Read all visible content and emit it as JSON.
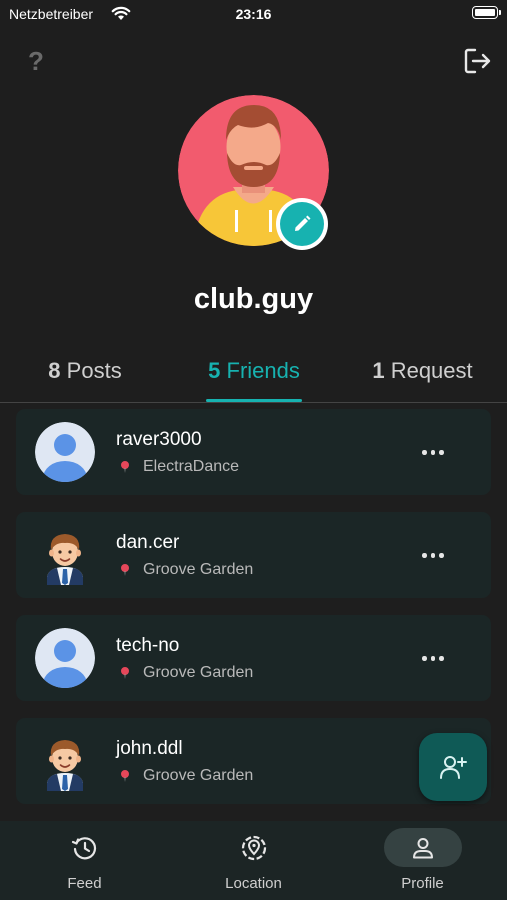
{
  "status_bar": {
    "carrier": "Netzbetreiber",
    "time": "23:16"
  },
  "profile": {
    "username": "club.guy"
  },
  "tabs": [
    {
      "count": "8",
      "label": "Posts"
    },
    {
      "count": "5",
      "label": "Friends",
      "active": true
    },
    {
      "count": "1",
      "label": "Request"
    }
  ],
  "friends": [
    {
      "name": "raver3000",
      "location": "ElectraDance",
      "avatar": "default-user-icon"
    },
    {
      "name": "dan.cer",
      "location": "Groove Garden",
      "avatar": "cartoon-man-icon"
    },
    {
      "name": "tech-no",
      "location": "Groove Garden",
      "avatar": "default-user-icon"
    },
    {
      "name": "john.ddl",
      "location": "Groove Garden",
      "avatar": "cartoon-man-icon"
    }
  ],
  "bottom_nav": [
    {
      "label": "Feed",
      "icon": "history-icon"
    },
    {
      "label": "Location",
      "icon": "location-target-icon"
    },
    {
      "label": "Profile",
      "icon": "person-icon",
      "active": true
    }
  ],
  "colors": {
    "accent": "#17b2b0",
    "background": "#1e1e1e",
    "card": "#1b2626",
    "fab": "#0f5a56",
    "nav": "#1c2525"
  }
}
